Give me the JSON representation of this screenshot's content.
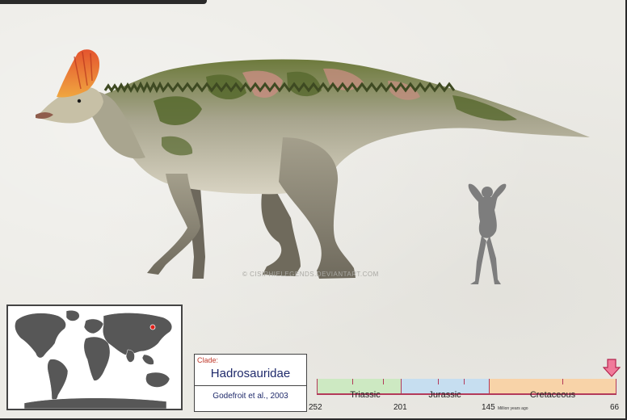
{
  "watermark": "© CISIPHIELEGENDS.DEVIANTART.COM",
  "clade": {
    "label": "Clade:",
    "name": "Hadrosauridae",
    "author": "Godefroit et al., 2003"
  },
  "map": {
    "location_marker_color": "#e0201a"
  },
  "timeline": {
    "periods": [
      {
        "name": "Triassic",
        "color": "#cde9c2"
      },
      {
        "name": "Jurassic",
        "color": "#c6def0"
      },
      {
        "name": "Cretaceous",
        "color": "#f8d3a8"
      }
    ],
    "boundaries": [
      "252",
      "201",
      "145",
      "66"
    ],
    "unit": "Million years ago",
    "marker_color": "#e84a7a"
  },
  "colors": {
    "background": "#ecebe6",
    "dino_body": "#b9b4a2",
    "dino_green": "#6b7b3a",
    "dino_pink": "#c98d82",
    "crest": "#e0603a",
    "human_silhouette": "#7d7d7d"
  }
}
